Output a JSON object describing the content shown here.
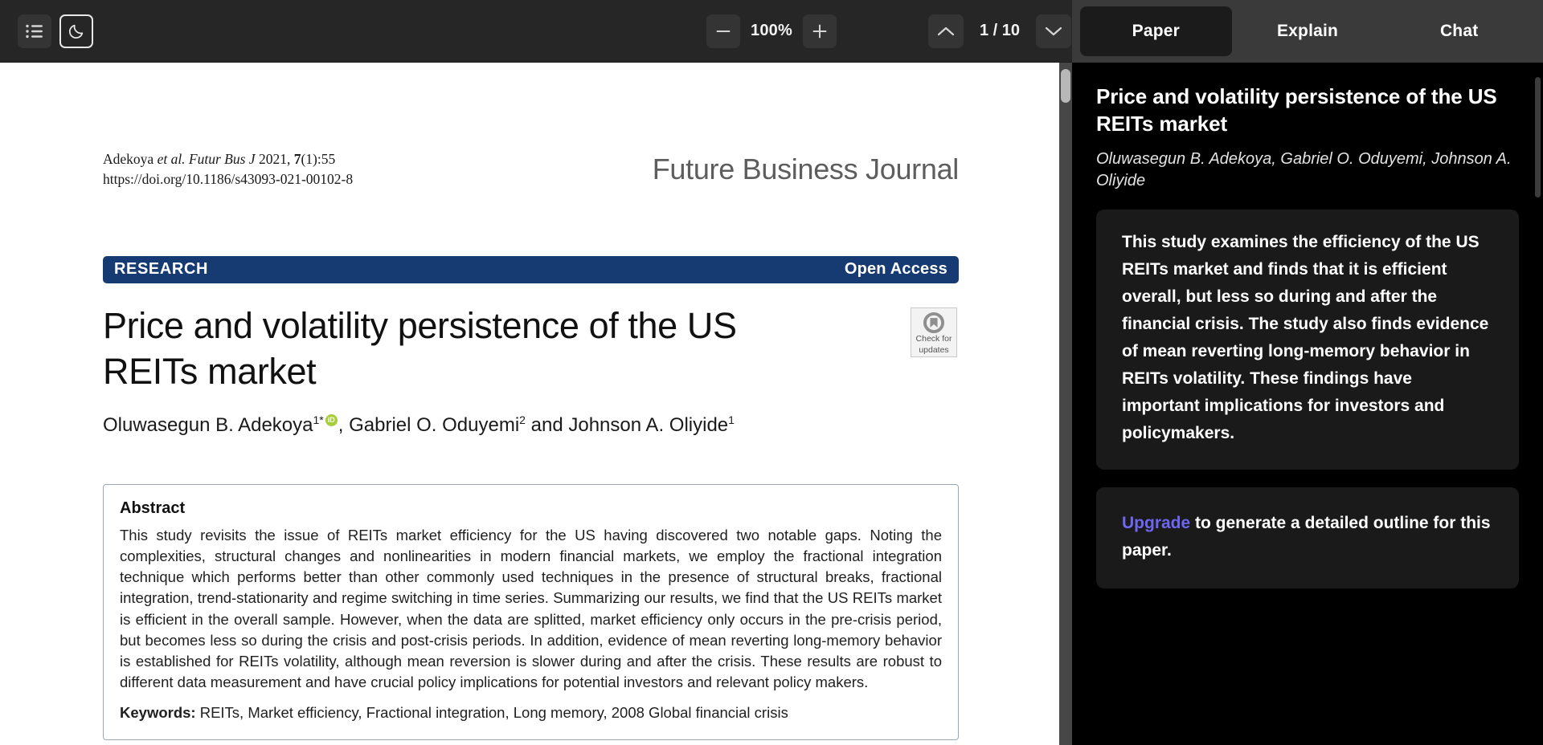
{
  "toolbar": {
    "outline_icon": "list-outline-icon",
    "theme_icon": "moon-icon",
    "zoom_out_icon": "minus-icon",
    "zoom_in_icon": "plus-icon",
    "zoom_level": "100%",
    "page_prev_icon": "chevron-up-icon",
    "page_next_icon": "chevron-down-icon",
    "page_indicator": "1 / 10"
  },
  "tabs": [
    {
      "label": "Paper",
      "active": true
    },
    {
      "label": "Explain",
      "active": false
    },
    {
      "label": "Chat",
      "active": false
    }
  ],
  "paper": {
    "citation_line1_a": "Adekoya ",
    "citation_line1_em": "et al. Futur Bus J",
    "citation_line1_b": " 2021, ",
    "citation_line1_vol": "7",
    "citation_line1_c": "(1):55",
    "citation_doi": "https://doi.org/10.1186/s43093-021-00102-8",
    "journal_name": "Future Business Journal",
    "banner_type": "RESEARCH",
    "banner_access": "Open Access",
    "title": "Price and volatility persistence of the US REITs market",
    "check_updates_line1": "Check for",
    "check_updates_line2": "updates",
    "authors_html": "Oluwasegun B. Adekoya",
    "author1_sup": "1*",
    "authors_mid": ", Gabriel O. Oduyemi",
    "author2_sup": "2",
    "authors_end": " and Johnson A. Oliyide",
    "author3_sup": "1",
    "abstract_heading": "Abstract",
    "abstract_body": "This study revisits the issue of REITs market efficiency for the US having discovered two notable gaps. Noting the complexities, structural changes and nonlinearities in modern financial markets, we employ the fractional integration technique which performs better than other commonly used techniques in the presence of structural breaks, fractional integration, trend-stationarity and regime switching in time series. Summarizing our results, we find that the US REITs market is efficient in the overall sample. However, when the data are splitted, market efficiency only occurs in the pre-crisis period, but becomes less so during the crisis and post-crisis periods. In addition, evidence of mean reverting long-memory behavior is established for REITs volatility, although mean reversion is slower during and after the crisis. These results are robust to different data measurement and have crucial policy implications for potential investors and relevant policy makers.",
    "keywords_label": "Keywords:",
    "keywords_value": " REITs, Market efficiency, Fractional integration, Long memory, 2008 Global financial crisis"
  },
  "panel": {
    "title": "Price and volatility persistence of the US REITs market",
    "authors": "Oluwasegun B. Adekoya, Gabriel O. Oduyemi, Johnson A. Oliyide",
    "summary": "This study examines the efficiency of the US REITs market and finds that it is efficient overall, but less so during and after the financial crisis. The study also finds evidence of mean reverting long-memory behavior in REITs volatility. These findings have important implications for investors and policymakers.",
    "upgrade_link": "Upgrade",
    "upgrade_rest": " to generate a detailed outline for this paper."
  },
  "colors": {
    "banner_navy": "#163a72",
    "orcid_green": "#a6ce39",
    "upgrade_purple": "#6f66f0",
    "toolbar_bg": "#262626",
    "tabs_bg": "#3a3a3a"
  }
}
